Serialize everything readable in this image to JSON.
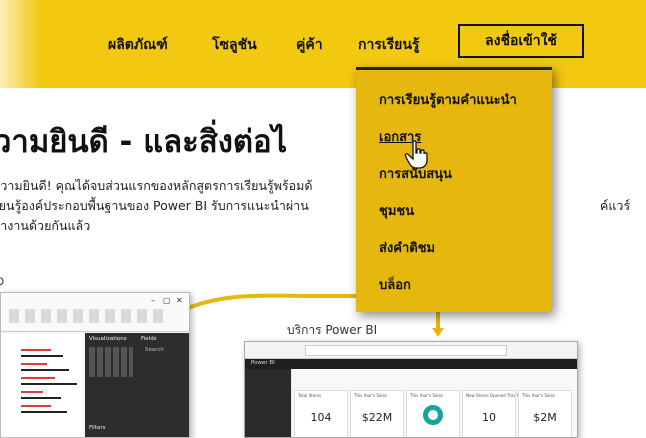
{
  "nav": {
    "items": [
      "ผลิตภัณฑ์",
      "โซลูชัน",
      "คู่ค้า",
      "การเรียนรู้"
    ],
    "signin_label": "ลงชื่อเข้าใช้"
  },
  "dropdown": {
    "items": [
      "การเรียนรู้ตามคำแนะนำ",
      "เอกสาร",
      "การสนับสนุน",
      "ชุมชน",
      "ส่งคำติชม",
      "บล็อก"
    ]
  },
  "hero": {
    "title": "วามยินดี - และสิ่งต่อไ",
    "line1": "ความยินดี! คุณได้จบส่วนแรกของหลักสูตรการเรียนรู้พร้อมด้",
    "line2": "รียนรู้องค์ประกอบพื้นฐานของ Power BI รับการแนะนำผ่าน",
    "line2_tail": "ค์แวร์",
    "line3": "ทำงานด้วยกันแล้ว"
  },
  "labels": {
    "app": "p",
    "service": "บริการ Power BI"
  },
  "desktop_panel": {
    "visualizations": "Visualizations",
    "fields": "Fields",
    "search": "Search",
    "filters": "Filters"
  },
  "service": {
    "product": "Power BI",
    "tiles": [
      {
        "title": "Total Stores",
        "value": "104"
      },
      {
        "title": "This Year's Sales",
        "value": "$22M"
      },
      {
        "title": "This Year's Sales",
        "value": ""
      },
      {
        "title": "New Stores Opened This Year",
        "value": "10"
      },
      {
        "title": "This Year's Sales",
        "value": "$2M"
      }
    ]
  },
  "colors": {
    "brand_yellow": "#f2c811",
    "dropdown_bg": "#e6b80f",
    "connector": "#e6b80f"
  }
}
